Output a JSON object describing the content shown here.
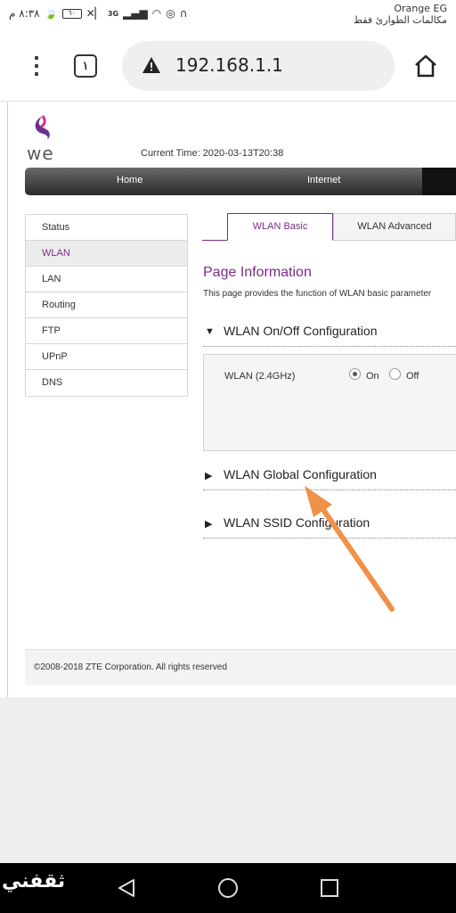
{
  "status_bar": {
    "time": "٨:٣٨ م",
    "battery": "٦٠",
    "network_type": "3G",
    "carrier": "Orange EG",
    "carrier_status": "مكالمات الطوارئ فقط"
  },
  "browser": {
    "tab_count": "١",
    "url": "192.168.1.1",
    "menu_icon": "vertical-dots-icon",
    "security_icon": "warning-triangle-icon",
    "home_icon": "home-icon"
  },
  "router": {
    "logo_text": "we",
    "current_time_label": "Current Time: 2020-03-13T20:38",
    "nav": [
      "Home",
      "Internet"
    ],
    "side_menu": [
      {
        "label": "Status",
        "active": false
      },
      {
        "label": "WLAN",
        "active": true
      },
      {
        "label": "LAN",
        "active": false
      },
      {
        "label": "Routing",
        "active": false
      },
      {
        "label": "FTP",
        "active": false
      },
      {
        "label": "UPnP",
        "active": false
      },
      {
        "label": "DNS",
        "active": false
      }
    ],
    "tabs": {
      "active": "WLAN Basic",
      "inactive": "WLAN Advanced"
    },
    "page_info": {
      "title": "Page Information",
      "description": "This page provides the function of WLAN basic parameter"
    },
    "sections": {
      "onoff": "WLAN On/Off Configuration",
      "global": "WLAN Global Configuration",
      "ssid": "WLAN SSID Configuration"
    },
    "wlan_band": {
      "label": "WLAN (2.4GHz)",
      "on_label": "On",
      "off_label": "Off",
      "selected": "On"
    },
    "footer": "©2008-2018 ZTE Corporation. All rights reserved"
  },
  "colors": {
    "accent": "#7a2c86",
    "annotation_arrow": "#f0914a"
  },
  "watermark": "ثقفني"
}
